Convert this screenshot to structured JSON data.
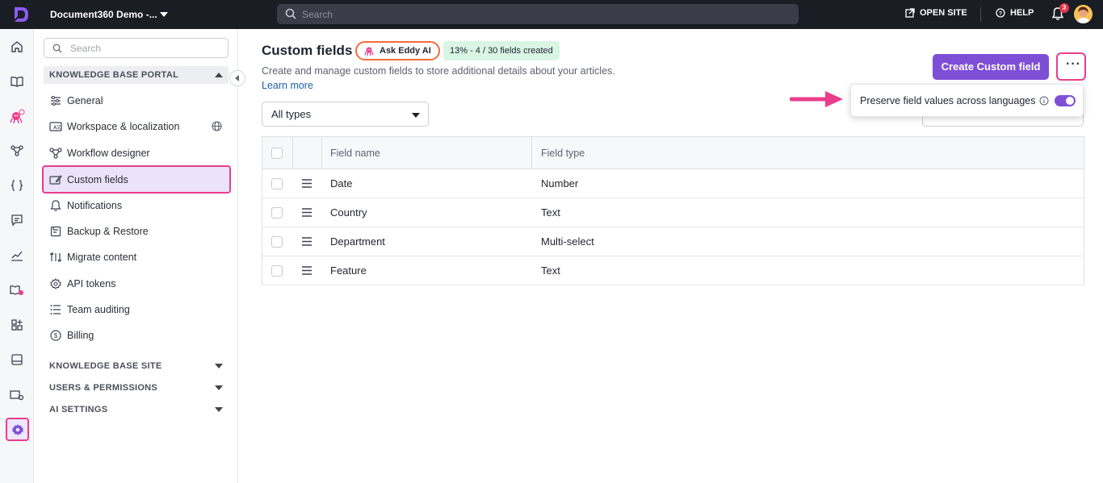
{
  "topbar": {
    "project_name": "Document360 Demo -...",
    "search_placeholder": "Search",
    "open_site_label": "OPEN SITE",
    "help_label": "HELP",
    "notification_count": "3"
  },
  "sidebar": {
    "search_placeholder": "Search",
    "sections": [
      {
        "label": "KNOWLEDGE BASE PORTAL"
      },
      {
        "label": "KNOWLEDGE BASE SITE"
      },
      {
        "label": "USERS & PERMISSIONS"
      },
      {
        "label": "AI SETTINGS"
      }
    ],
    "items": [
      {
        "label": "General",
        "icon": "sliders-icon"
      },
      {
        "label": "Workspace & localization",
        "icon": "translate-icon"
      },
      {
        "label": "Workflow designer",
        "icon": "workflow-icon"
      },
      {
        "label": "Custom fields",
        "icon": "edit-field-icon",
        "active": true
      },
      {
        "label": "Notifications",
        "icon": "bell-icon"
      },
      {
        "label": "Backup & Restore",
        "icon": "backup-icon"
      },
      {
        "label": "Migrate content",
        "icon": "migrate-icon"
      },
      {
        "label": "API tokens",
        "icon": "gear-token-icon"
      },
      {
        "label": "Team auditing",
        "icon": "list-icon"
      },
      {
        "label": "Billing",
        "icon": "dollar-icon"
      }
    ]
  },
  "main": {
    "title": "Custom fields",
    "ask_eddy_label": "Ask Eddy AI",
    "count_badge": "13% - 4 / 30 fields created",
    "subtitle": "Create and manage custom fields to store additional details about your articles.",
    "learn_more": "Learn more",
    "create_button": "Create Custom field",
    "more_button": "···",
    "type_filter": "All types",
    "popover_label": "Preserve field values across languages",
    "table": {
      "headers": [
        "Field name",
        "Field type"
      ],
      "rows": [
        {
          "name": "Date",
          "type": "Number"
        },
        {
          "name": "Country",
          "type": "Text"
        },
        {
          "name": "Department",
          "type": "Multi-select"
        },
        {
          "name": "Feature",
          "type": "Text"
        }
      ]
    }
  },
  "colors": {
    "accent": "#7e4fd6",
    "highlight": "#e83e8c",
    "topbar": "#1b1d24"
  }
}
